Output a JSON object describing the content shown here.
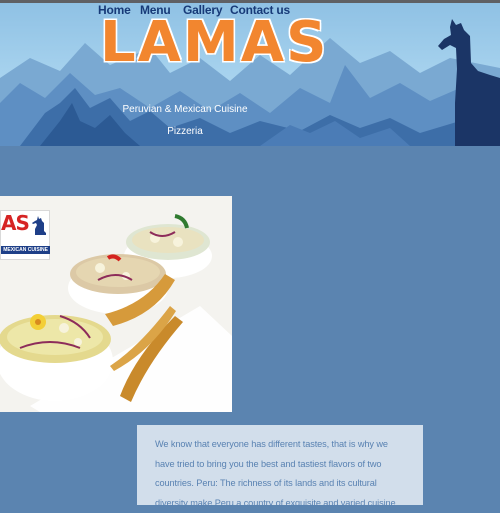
{
  "nav": {
    "items": [
      {
        "label": "Home"
      },
      {
        "label": "Menu"
      },
      {
        "label": "Gallery"
      },
      {
        "label": "Contact us"
      }
    ]
  },
  "brand": {
    "logo_text": "LAMAS",
    "tagline": "Peruvian & Mexican Cuisine",
    "subtagline": "Pizzeria"
  },
  "photo": {
    "badge_title": "AS",
    "badge_subtitle": "MEXICAN CUISINE"
  },
  "about": {
    "text": "We know that everyone has different tastes, that is why we have tried to bring you the best and tastiest flavors of two countries. Peru: The richness of its lands and its cultural diversity make Peru a country of exquisite and varied cuisine"
  },
  "colors": {
    "page_bg": "#5b84b0",
    "nav_text": "#173a78",
    "logo_orange": "#f2862f",
    "card_bg": "#d2deeb",
    "card_text": "#5982b2"
  },
  "icons": [
    "llama-silhouette-icon",
    "mountains-graphic"
  ]
}
